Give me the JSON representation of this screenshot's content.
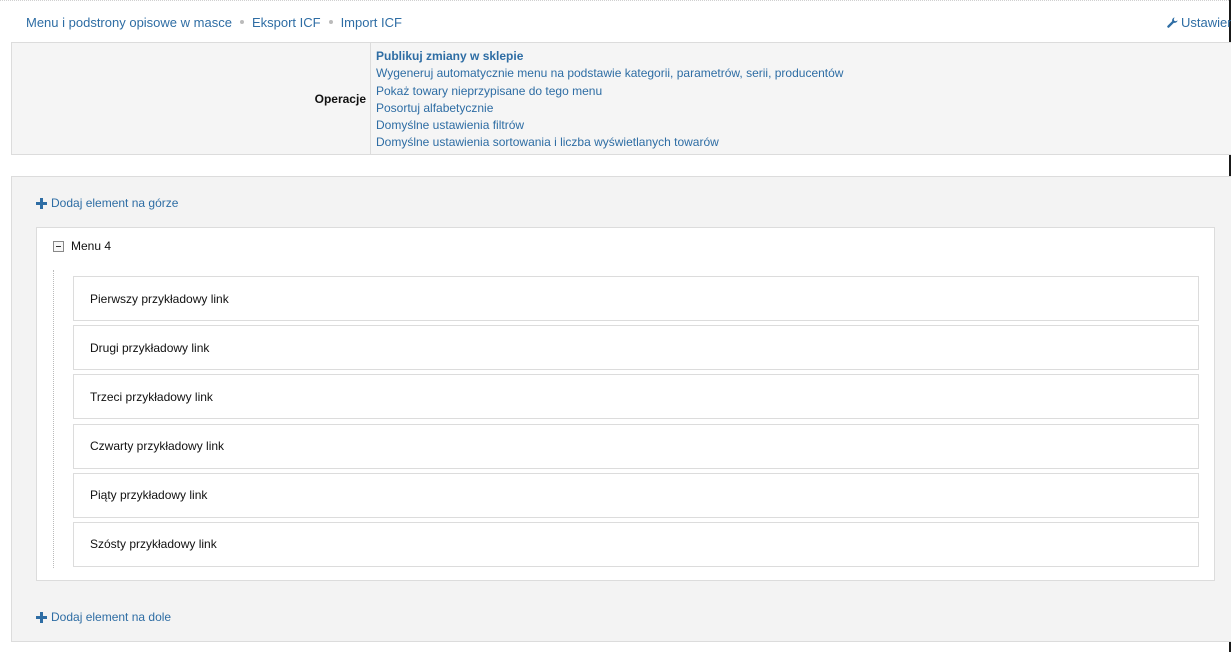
{
  "topnav": {
    "links": [
      "Menu i podstrony opisowe w masce",
      "Eksport ICF",
      "Import ICF"
    ],
    "settings_label": "Ustawien"
  },
  "operations": {
    "label": "Operacje",
    "links": [
      "Publikuj zmiany w sklepie",
      "Wygeneruj automatycznie menu na podstawie kategorii, parametrów, serii, producentów",
      "Pokaż towary nieprzypisane do tego menu",
      "Posortuj alfabetycznie",
      "Domyślne ustawienia filtrów",
      "Domyślne ustawienia sortowania i liczba wyświetlanych towarów"
    ]
  },
  "panel": {
    "add_top": "Dodaj element na górze",
    "add_bottom": "Dodaj element na dole",
    "menu": {
      "title": "Menu 4",
      "items": [
        "Pierwszy przykładowy link",
        "Drugi przykładowy link",
        "Trzeci przykładowy link",
        "Czwarty przykładowy link",
        "Piąty przykładowy link",
        "Szósty przykładowy link"
      ]
    }
  },
  "colors": {
    "link": "#2e6da4",
    "panel_bg": "#f3f3f3",
    "border": "#dcdcdc"
  },
  "icons": {
    "settings": "wrench-icon",
    "add": "plus-icon",
    "collapse": "minus-box-icon"
  }
}
